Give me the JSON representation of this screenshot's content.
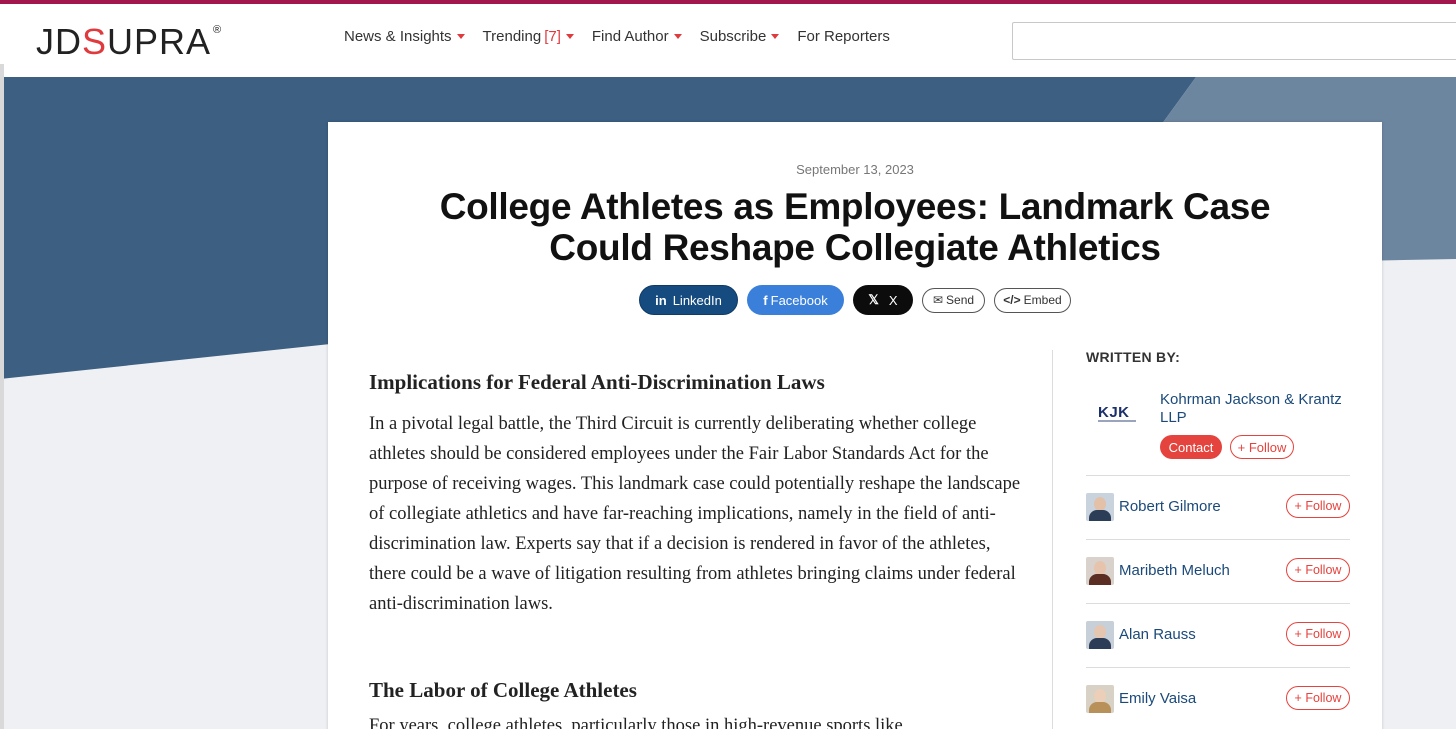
{
  "header": {
    "logo": "JDSUPRA",
    "logo_parts": [
      "JD",
      "S",
      "UPRA"
    ],
    "logo_reg": "®",
    "nav": [
      {
        "label": "News & Insights",
        "caret": true
      },
      {
        "label": "Trending",
        "count": "[7]",
        "caret": true
      },
      {
        "label": "Find Author",
        "caret": true
      },
      {
        "label": "Subscribe",
        "caret": true
      },
      {
        "label": "For Reporters",
        "caret": false
      }
    ],
    "search_value": ""
  },
  "article": {
    "date": "September 13, 2023",
    "title": "College Athletes as Employees: Landmark Case Could Reshape Collegiate Athletics",
    "share": {
      "linkedin": "LinkedIn",
      "facebook": "Facebook",
      "x": "X",
      "send": "Send",
      "embed": "Embed"
    },
    "section1_heading": "Implications for Federal Anti-Discrimination Laws",
    "section1_body": "In a pivotal legal battle, the Third Circuit is currently deliberating whether college athletes should be considered employees under the Fair Labor Standards Act for the purpose of receiving wages. This landmark case could potentially reshape the landscape of collegiate athletics and have far-reaching implications, namely in the field of anti-discrimination law. Experts say that if a decision is rendered in favor of the athletes, there could be a wave of litigation resulting from athletes bringing claims under federal anti-discrimination laws.",
    "section2_heading": "The Labor of College Athletes",
    "section2_partial": "For years, college athletes, particularly those in high-revenue sports like"
  },
  "sidebar": {
    "written_by": "WRITTEN BY:",
    "firm": {
      "logo_text": "KJK",
      "name": "Kohrman Jackson & Krantz LLP",
      "contact_label": "Contact",
      "follow_label": "+ Follow"
    },
    "authors": [
      {
        "name": "Robert Gilmore",
        "follow_label": "+ Follow"
      },
      {
        "name": "Maribeth Meluch",
        "follow_label": "+ Follow"
      },
      {
        "name": "Alan Rauss",
        "follow_label": "+ Follow"
      },
      {
        "name": "Emily Vaisa",
        "follow_label": "+ Follow"
      }
    ]
  },
  "colors": {
    "brand_red": "#e03a3e",
    "top_line": "#a3174f",
    "hero_blue": "#3d5f82",
    "linkedin": "#164b7f",
    "facebook": "#3a7fd9",
    "link_blue": "#1b4a7a"
  },
  "icons": [
    "linkedin-icon",
    "facebook-icon",
    "x-icon",
    "envelope-icon",
    "code-icon",
    "caret-down-icon"
  ]
}
